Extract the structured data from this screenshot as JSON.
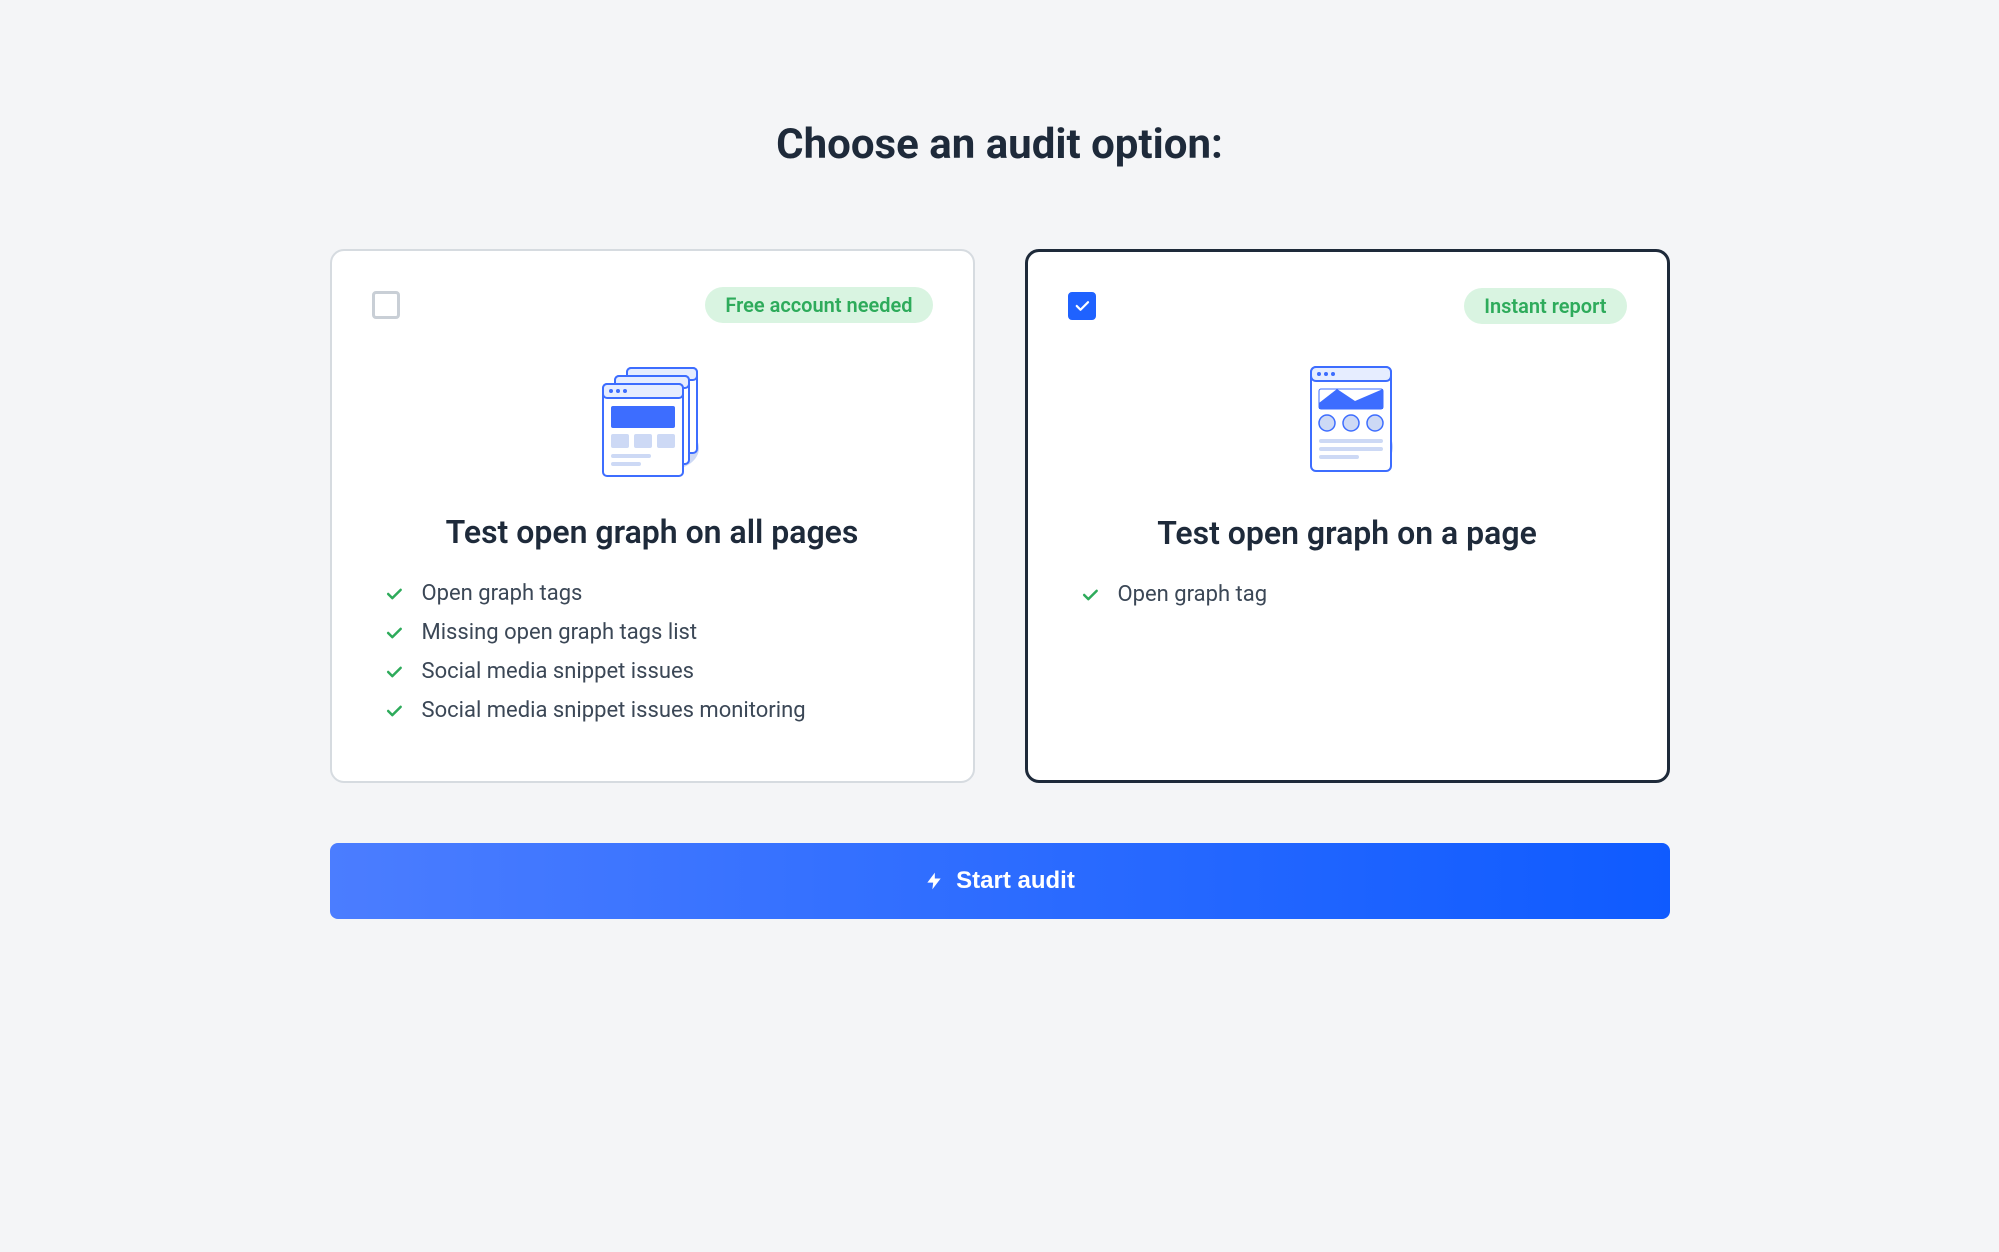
{
  "heading": "Choose an audit option:",
  "cards": [
    {
      "badge": "Free account needed",
      "title": "Test open graph on all pages",
      "selected": false,
      "features": [
        "Open graph tags",
        "Missing open graph tags list",
        "Social media snippet issues",
        "Social media snippet issues monitoring"
      ]
    },
    {
      "badge": "Instant report",
      "title": "Test open graph on a page",
      "selected": true,
      "features": [
        "Open graph tag"
      ]
    }
  ],
  "button": "Start audit"
}
